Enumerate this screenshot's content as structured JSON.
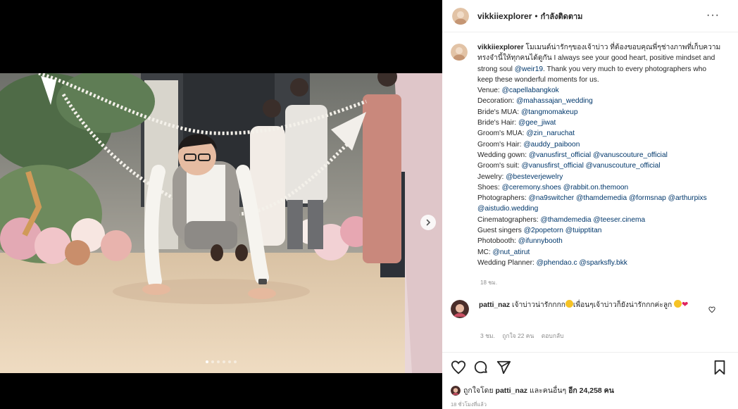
{
  "post": {
    "username": "vikkiiexplorer",
    "separator": "•",
    "follow_label": "กำลังติดตาม",
    "more_label": "···",
    "icons": [
      "avatar",
      "more-icon",
      "next-icon",
      "heart-icon",
      "comment-icon",
      "share-icon",
      "save-icon"
    ]
  },
  "media": {
    "carousel": {
      "count": 6,
      "active": 0
    }
  },
  "caption": {
    "username": "vikkiiexplorer",
    "text_intro": "โมเมนต์น่ารักๆของเจ้าบ่าว ที่ต้องขอบคุณพี่ๆช่างภาพที่เก็บความทรงจำนี้ให้ทุกคนได้ดูกัน I always see your good heart, positive mindset and strong soul",
    "mention_intro": "@weir19",
    "text_thanks": ". Thank you very much to every photographers who keep these wonderful moments for us.",
    "credits": [
      {
        "label": "Venue: ",
        "mentions": [
          "@capellabangkok"
        ]
      },
      {
        "label": "Decoration: ",
        "mentions": [
          "@mahassajan_wedding"
        ]
      },
      {
        "label": "Bride's MUA: ",
        "mentions": [
          "@tangmomakeup"
        ]
      },
      {
        "label": "Bride's Hair: ",
        "mentions": [
          "@gee_jiwat"
        ]
      },
      {
        "label": "Groom's MUA: ",
        "mentions": [
          "@zin_naruchat"
        ]
      },
      {
        "label": "Groom's Hair: ",
        "mentions": [
          "@auddy_paiboon"
        ]
      },
      {
        "label": "Wedding gown: ",
        "mentions": [
          "@vanusfirst_official",
          "@vanuscouture_official"
        ]
      },
      {
        "label": "Groom's suit: ",
        "mentions": [
          "@vanusfirst_official",
          "@vanuscouture_official"
        ]
      },
      {
        "label": "Jewelry: ",
        "mentions": [
          "@besteverjewelry"
        ]
      },
      {
        "label": "Shoes: ",
        "mentions": [
          "@ceremony.shoes",
          "@rabbit.on.themoon"
        ]
      },
      {
        "label": "Photographers: ",
        "mentions": [
          "@na9switcher",
          "@thamdemedia",
          "@formsnap",
          "@arthurpixs",
          "@aistudio.wedding"
        ]
      },
      {
        "label": "Cinematographers: ",
        "mentions": [
          "@thamdemedia",
          "@teeser.cinema"
        ]
      },
      {
        "label": "Guest singers ",
        "mentions": [
          "@2popetorn",
          "@tuipptitan"
        ]
      },
      {
        "label": "Photobooth: ",
        "mentions": [
          "@ifunnybooth"
        ]
      },
      {
        "label": "MC: ",
        "mentions": [
          "@nut_atirut"
        ]
      },
      {
        "label": "Wedding Planner: ",
        "mentions": [
          "@phendao.c",
          "@sparksfly.bkk"
        ]
      }
    ],
    "time": "18 ชม."
  },
  "comment": {
    "username": "patti_naz",
    "text_a": "เจ้าบ่าวน่ารักกกก",
    "text_b": "เพื่อนๆเจ้าบ่าวก็ยังน่ารักกกค่ะลูก",
    "heart_emoji": "❤",
    "time": "3 ชม.",
    "likes": "ถูกใจ 22 คน",
    "reply": "ตอบกลับ"
  },
  "likes_summary": {
    "prefix": "ถูกใจโดย",
    "user": "patti_naz",
    "middle": "และคนอื่นๆ",
    "others": "อีก 24,258 คน"
  },
  "post_time": "18 ชั่วโมงที่แล้ว",
  "colors": {
    "mention": "#00376b",
    "muted": "#8e8e8e",
    "text": "#262626",
    "floor": "#e8d2b3"
  }
}
